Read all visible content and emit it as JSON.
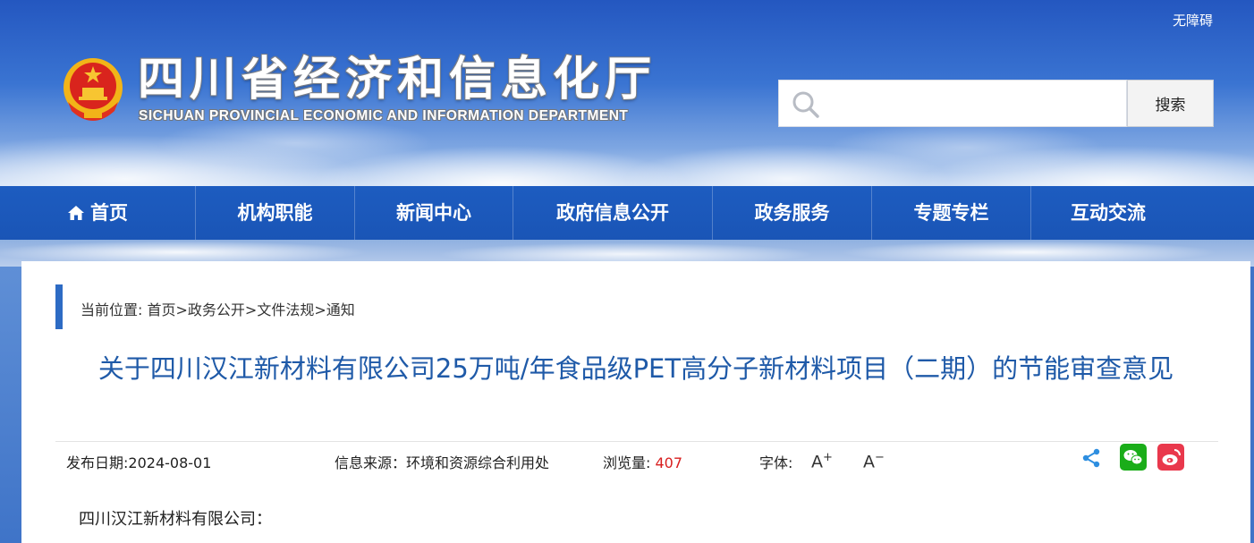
{
  "header": {
    "accessibility_label": "无障碍",
    "site_title": "四川省经济和信息化厅",
    "site_subtitle": "SICHUAN PROVINCIAL ECONOMIC AND INFORMATION DEPARTMENT",
    "search_placeholder": "",
    "search_button_label": "搜索"
  },
  "nav": {
    "items": [
      {
        "label": "首页",
        "icon": "home-icon"
      },
      {
        "label": "机构职能"
      },
      {
        "label": "新闻中心"
      },
      {
        "label": "政府信息公开"
      },
      {
        "label": "政务服务"
      },
      {
        "label": "专题专栏"
      },
      {
        "label": "互动交流"
      }
    ]
  },
  "breadcrumb": {
    "prefix": "当前位置: ",
    "items": [
      "首页",
      "政务公开",
      "文件法规",
      "通知"
    ],
    "separator": ">"
  },
  "article": {
    "title": "关于四川汉江新材料有限公司25万吨/年食品级PET高分子新材料项目（二期）的节能审查意见",
    "publish_label": "发布日期:",
    "publish_date": "2024-08-01",
    "source_label": "信息来源：",
    "source": "环境和资源综合利用处",
    "views_label": "浏览量: ",
    "views": "407",
    "font_label": "字体:",
    "font_increase": "A",
    "font_decrease": "A",
    "salutation": "四川汉江新材料有限公司："
  },
  "colors": {
    "nav_bg": "#1d5cc0",
    "title_blue": "#1f5aa8",
    "views_red": "#d81e1e",
    "wechat_green": "#1aad19",
    "weibo_red": "#e6162d"
  }
}
